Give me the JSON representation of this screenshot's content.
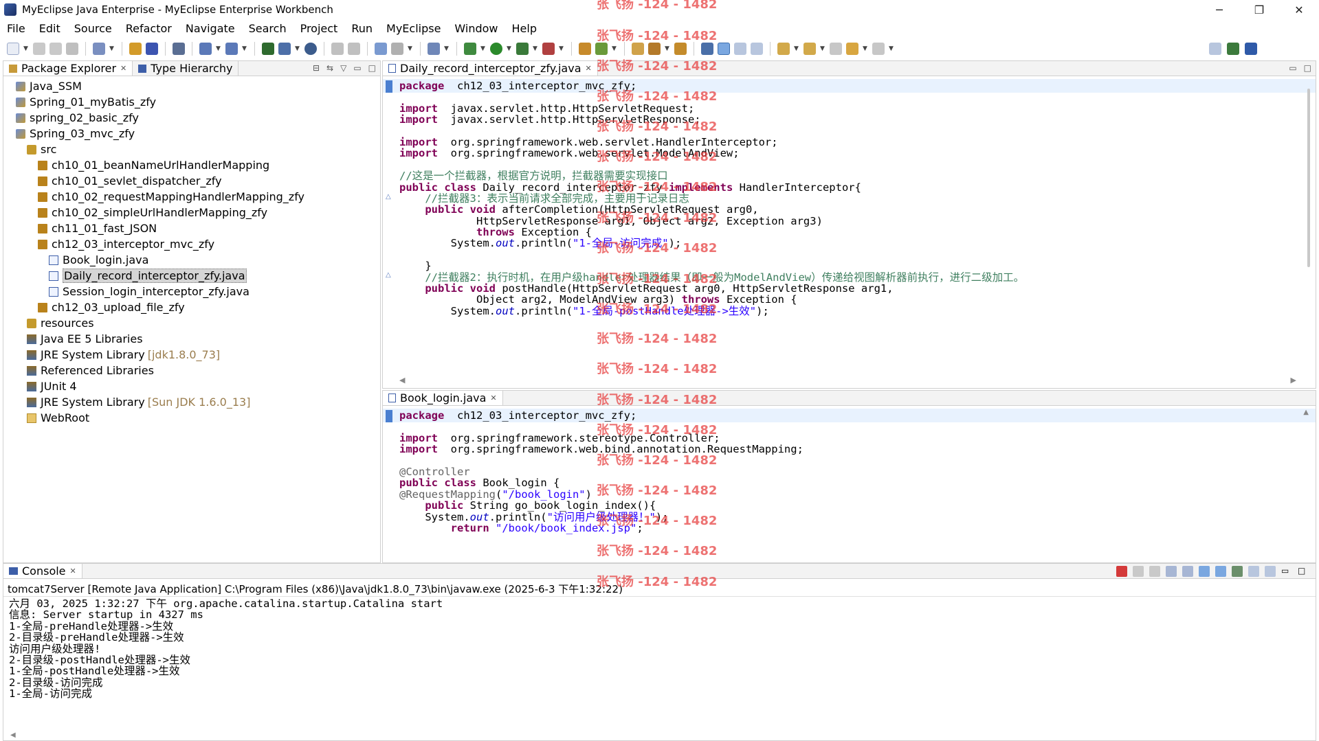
{
  "window": {
    "title": "MyEclipse Java Enterprise - MyEclipse Enterprise Workbench",
    "minimize": "─",
    "restore": "❐",
    "close": "✕"
  },
  "menu": [
    "File",
    "Edit",
    "Source",
    "Refactor",
    "Navigate",
    "Search",
    "Project",
    "Run",
    "MyEclipse",
    "Window",
    "Help"
  ],
  "package_explorer": {
    "tab_label": "Package Explorer",
    "tab2_label": "Type Hierarchy",
    "items": [
      {
        "label": "Java_SSM",
        "indent": 0,
        "icon": "project-icon"
      },
      {
        "label": "Spring_01_myBatis_zfy",
        "indent": 0,
        "icon": "project-icon"
      },
      {
        "label": "spring_02_basic_zfy",
        "indent": 0,
        "icon": "project-icon"
      },
      {
        "label": "Spring_03_mvc_zfy",
        "indent": 0,
        "icon": "project-icon"
      },
      {
        "label": "src",
        "indent": 1,
        "icon": "source-folder-icon"
      },
      {
        "label": "ch10_01_beanNameUrlHandlerMapping",
        "indent": 2,
        "icon": "package-icon"
      },
      {
        "label": "ch10_01_sevlet_dispatcher_zfy",
        "indent": 2,
        "icon": "package-icon"
      },
      {
        "label": "ch10_02_requestMappingHandlerMapping_zfy",
        "indent": 2,
        "icon": "package-icon"
      },
      {
        "label": "ch10_02_simpleUrlHandlerMapping_zfy",
        "indent": 2,
        "icon": "package-icon"
      },
      {
        "label": "ch11_01_fast_JSON",
        "indent": 2,
        "icon": "package-icon"
      },
      {
        "label": "ch12_03_interceptor_mvc_zfy",
        "indent": 2,
        "icon": "package-icon"
      },
      {
        "label": "Book_login.java",
        "indent": 3,
        "icon": "java-file-icon"
      },
      {
        "label": "Daily_record_interceptor_zfy.java",
        "indent": 3,
        "icon": "java-file-icon",
        "selected": true
      },
      {
        "label": "Session_login_interceptor_zfy.java",
        "indent": 3,
        "icon": "java-file-icon"
      },
      {
        "label": "ch12_03_upload_file_zfy",
        "indent": 2,
        "icon": "package-icon"
      },
      {
        "label": "resources",
        "indent": 1,
        "icon": "source-folder-icon"
      },
      {
        "label": "Java EE 5 Libraries",
        "indent": 1,
        "icon": "library-icon"
      },
      {
        "label": "JRE System Library",
        "indent": 1,
        "icon": "library-icon",
        "suffix": "[jdk1.8.0_73]"
      },
      {
        "label": "Referenced Libraries",
        "indent": 1,
        "icon": "library-icon"
      },
      {
        "label": "JUnit 4",
        "indent": 1,
        "icon": "library-icon"
      },
      {
        "label": "JRE System Library",
        "indent": 1,
        "icon": "library-icon",
        "suffix": "[Sun JDK 1.6.0_13]"
      },
      {
        "label": "WebRoot",
        "indent": 1,
        "icon": "folder-icon"
      }
    ]
  },
  "editor1": {
    "tab_label": "Daily_record_interceptor_zfy.java",
    "lines": [
      [
        [
          "kw",
          "package"
        ],
        [
          "",
          "  ch12_03_interceptor_mvc_zfy;"
        ]
      ],
      [],
      [
        [
          "kw",
          "import"
        ],
        [
          "",
          "  javax.servlet.http.HttpServletRequest;"
        ]
      ],
      [
        [
          "kw",
          "import"
        ],
        [
          "",
          "  javax.servlet.http.HttpServletResponse;"
        ]
      ],
      [],
      [
        [
          "kw",
          "import"
        ],
        [
          "",
          "  org.springframework.web.servlet.HandlerInterceptor;"
        ]
      ],
      [
        [
          "kw",
          "import"
        ],
        [
          "",
          "  org.springframework.web.servlet.ModelAndView;"
        ]
      ],
      [],
      [
        [
          "cm",
          "//这是一个拦截器，根据官方说明，拦截器需要实现接口"
        ]
      ],
      [
        [
          "kw",
          "public"
        ],
        [
          "",
          " "
        ],
        [
          "kw",
          "class"
        ],
        [
          "",
          " Daily_record_interceptor_zfy "
        ],
        [
          "kw",
          "implements"
        ],
        [
          "",
          " HandlerInterceptor{"
        ]
      ],
      [
        [
          "",
          "    "
        ],
        [
          "cm",
          "//拦截器3：表示当前请求全部完成，主要用于记录日志"
        ]
      ],
      [
        [
          "",
          "    "
        ],
        [
          "kw",
          "public"
        ],
        [
          "",
          " "
        ],
        [
          "kw",
          "void"
        ],
        [
          "",
          " afterCompletion(HttpServletRequest arg0,"
        ]
      ],
      [
        [
          "",
          "            HttpServletResponse arg1, Object arg2, Exception arg3)"
        ]
      ],
      [
        [
          "",
          "            "
        ],
        [
          "kw",
          "throws"
        ],
        [
          "",
          " Exception {"
        ]
      ],
      [
        [
          "",
          "        System."
        ],
        [
          "fld",
          "out"
        ],
        [
          "",
          ".println("
        ],
        [
          "st",
          "\"1-全局-访问完成\""
        ],
        [
          "",
          ");"
        ]
      ],
      [],
      [
        [
          "",
          "    }"
        ]
      ],
      [
        [
          "",
          "    "
        ],
        [
          "cm",
          "//拦截器2：执行时机，在用户级handler处理器结果（即一般为ModelAndView）传递给视图解析器前执行，进行二级加工。"
        ]
      ],
      [
        [
          "",
          "    "
        ],
        [
          "kw",
          "public"
        ],
        [
          "",
          " "
        ],
        [
          "kw",
          "void"
        ],
        [
          "",
          " postHandle(HttpServletRequest arg0, HttpServletResponse arg1,"
        ]
      ],
      [
        [
          "",
          "            Object arg2, ModelAndView arg3) "
        ],
        [
          "kw",
          "throws"
        ],
        [
          "",
          " Exception {"
        ]
      ],
      [
        [
          "",
          "        System."
        ],
        [
          "fld",
          "out"
        ],
        [
          "",
          ".println("
        ],
        [
          "st",
          "\"1-全局-postHandle处理器->生效\""
        ],
        [
          "",
          ");"
        ]
      ]
    ]
  },
  "editor2": {
    "tab_label": "Book_login.java",
    "lines": [
      [
        [
          "kw",
          "package"
        ],
        [
          "",
          "  ch12_03_interceptor_mvc_zfy;"
        ]
      ],
      [],
      [
        [
          "kw",
          "import"
        ],
        [
          "",
          "  org.springframework.stereotype.Controller;"
        ]
      ],
      [
        [
          "kw",
          "import"
        ],
        [
          "",
          "  org.springframework.web.bind.annotation.RequestMapping;"
        ]
      ],
      [],
      [
        [
          "ann",
          "@Controller"
        ]
      ],
      [
        [
          "kw",
          "public"
        ],
        [
          "",
          " "
        ],
        [
          "kw",
          "class"
        ],
        [
          "",
          " Book_login {"
        ]
      ],
      [
        [
          "ann",
          "@RequestMapping"
        ],
        [
          "",
          "("
        ],
        [
          "st",
          "\"/book_login\""
        ],
        [
          "",
          ")"
        ]
      ],
      [
        [
          "",
          "    "
        ],
        [
          "kw",
          "public"
        ],
        [
          "",
          " String go_book_login_index(){"
        ]
      ],
      [
        [
          "",
          "    System."
        ],
        [
          "fld",
          "out"
        ],
        [
          "",
          ".println("
        ],
        [
          "st",
          "\"访问用户级处理器！\""
        ],
        [
          "",
          ");"
        ]
      ],
      [
        [
          "",
          "        "
        ],
        [
          "kw",
          "return"
        ],
        [
          "",
          " "
        ],
        [
          "st",
          "\"/book/book_index.jsp\""
        ],
        [
          "",
          ";"
        ]
      ]
    ]
  },
  "console": {
    "tab_label": "Console",
    "header": "tomcat7Server [Remote Java Application] C:\\Program Files (x86)\\Java\\jdk1.8.0_73\\bin\\javaw.exe (2025-6-3 下午1:32:22)",
    "lines": [
      "六月 03, 2025 1:32:27 下午 org.apache.catalina.startup.Catalina start",
      "信息: Server startup in 4327 ms",
      "1-全局-preHandle处理器->生效",
      "2-目录级-preHandle处理器->生效",
      "访问用户级处理器!",
      "2-目录级-postHandle处理器->生效",
      "1-全局-postHandle处理器->生效",
      "2-目录级-访问完成",
      "1-全局-访问完成"
    ]
  },
  "watermark": "张飞扬 -124 - 1482",
  "colors": {
    "keyword": "#7f0055",
    "comment": "#3f7f5f",
    "string": "#2a00ff",
    "field": "#0000c0",
    "watermark": "#e63c3c"
  }
}
